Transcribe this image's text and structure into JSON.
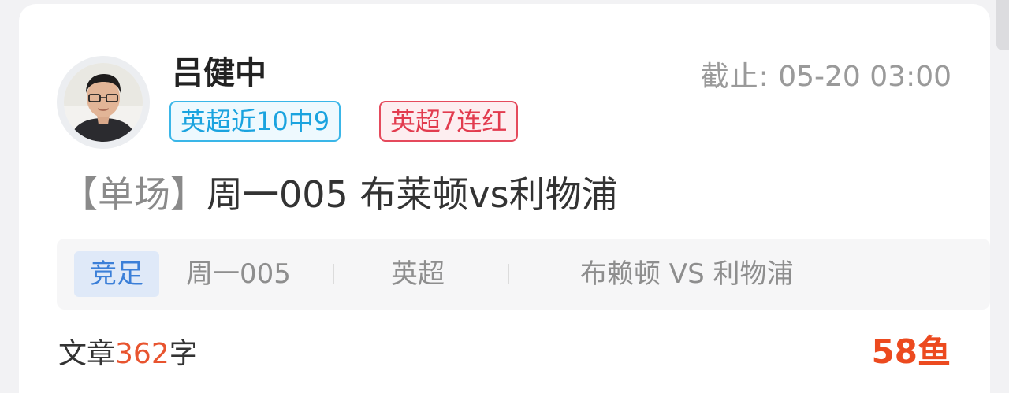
{
  "author": {
    "name": "吕健中"
  },
  "deadline": {
    "label": "截止:",
    "value": "05-20 03:00"
  },
  "tags": [
    {
      "label": "英超近10中9",
      "color": "#1aa3df"
    },
    {
      "label": "英超7连红",
      "color": "#e23b4e"
    }
  ],
  "article": {
    "type_bracket": "【单场】",
    "title": "周一005 布莱顿vs利物浦"
  },
  "match": {
    "sport": "竞足",
    "code": "周一005",
    "league": "英超",
    "teams": "布赖顿 VS 利物浦"
  },
  "footer": {
    "words_prefix": "文章",
    "words_count": "362",
    "words_suffix": "字",
    "price": "58鱼"
  }
}
